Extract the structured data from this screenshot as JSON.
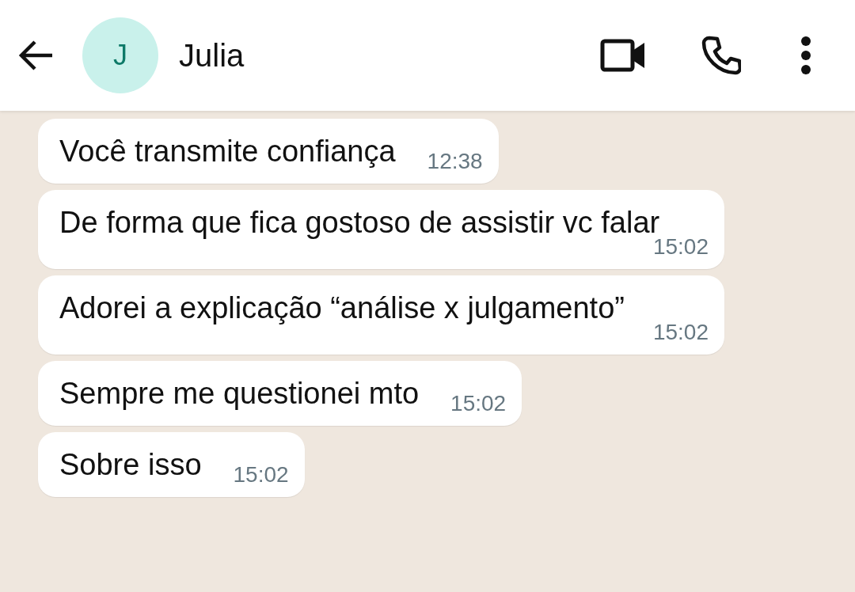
{
  "header": {
    "avatar_initial": "J",
    "name": "Julia"
  },
  "messages": [
    {
      "text": "Você transmite confiança",
      "time": "12:38"
    },
    {
      "text": "De forma que fica gostoso de assistir vc falar",
      "time": "15:02"
    },
    {
      "text": "Adorei a explicação “análise x julgamento”",
      "time": "15:02"
    },
    {
      "text": "Sempre me questionei mto",
      "time": "15:02"
    },
    {
      "text": "Sobre isso",
      "time": "15:02"
    }
  ]
}
